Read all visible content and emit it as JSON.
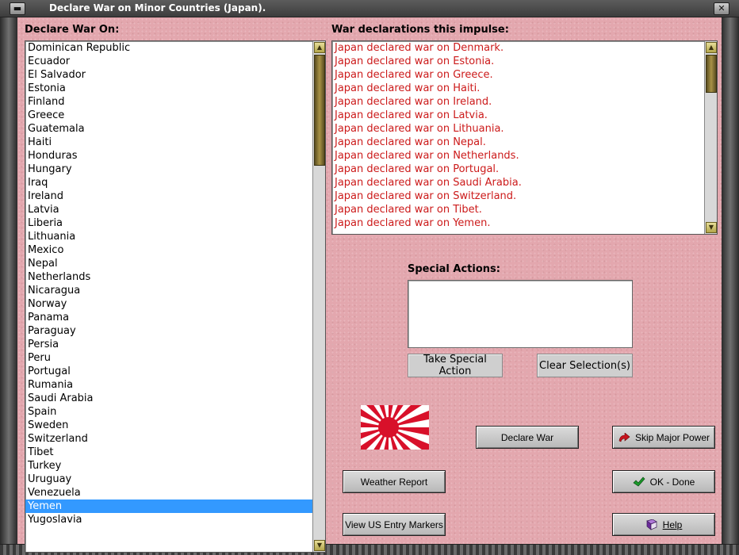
{
  "window": {
    "title": "Declare War on Minor Countries (Japan)."
  },
  "left_panel": {
    "label": "Declare War On:",
    "countries": [
      "Dominican Republic",
      "Ecuador",
      "El Salvador",
      "Estonia",
      "Finland",
      "Greece",
      "Guatemala",
      "Haiti",
      "Honduras",
      "Hungary",
      "Iraq",
      "Ireland",
      "Latvia",
      "Liberia",
      "Lithuania",
      "Mexico",
      "Nepal",
      "Netherlands",
      "Nicaragua",
      "Norway",
      "Panama",
      "Paraguay",
      "Persia",
      "Peru",
      "Portugal",
      "Rumania",
      "Saudi Arabia",
      "Spain",
      "Sweden",
      "Switzerland",
      "Tibet",
      "Turkey",
      "Uruguay",
      "Venezuela",
      "Yemen",
      "Yugoslavia"
    ],
    "selected": "Yemen"
  },
  "right_panel": {
    "label": "War declarations this impulse:",
    "declarations": [
      "Japan declared war on Denmark.",
      "Japan declared war on Estonia.",
      "Japan declared war on Greece.",
      "Japan declared war on Haiti.",
      "Japan declared war on Ireland.",
      "Japan declared war on Latvia.",
      "Japan declared war on Lithuania.",
      "Japan declared war on Nepal.",
      "Japan declared war on Netherlands.",
      "Japan declared war on Portugal.",
      "Japan declared war on Saudi Arabia.",
      "Japan declared war on Switzerland.",
      "Japan declared war on Tibet.",
      "Japan declared war on Yemen."
    ]
  },
  "special_actions": {
    "label": "Special Actions:",
    "take_label": "Take Special Action",
    "clear_label": "Clear Selection(s)"
  },
  "buttons": {
    "declare_war": "Declare War",
    "skip_major_power": "Skip Major Power",
    "weather_report": "Weather Report",
    "ok_done": "OK - Done",
    "view_us_entry": "View US Entry Markers",
    "help": "Help"
  },
  "colors": {
    "panel_bg": "#e3a7ae",
    "declaration_text": "#cc1a1a",
    "selection": "#3399ff",
    "flag_red": "#d8102a"
  },
  "icons": {
    "flag": "rising-sun-flag-icon",
    "skip": "red-arrow-icon",
    "ok": "green-check-icon",
    "help": "book-icon"
  }
}
